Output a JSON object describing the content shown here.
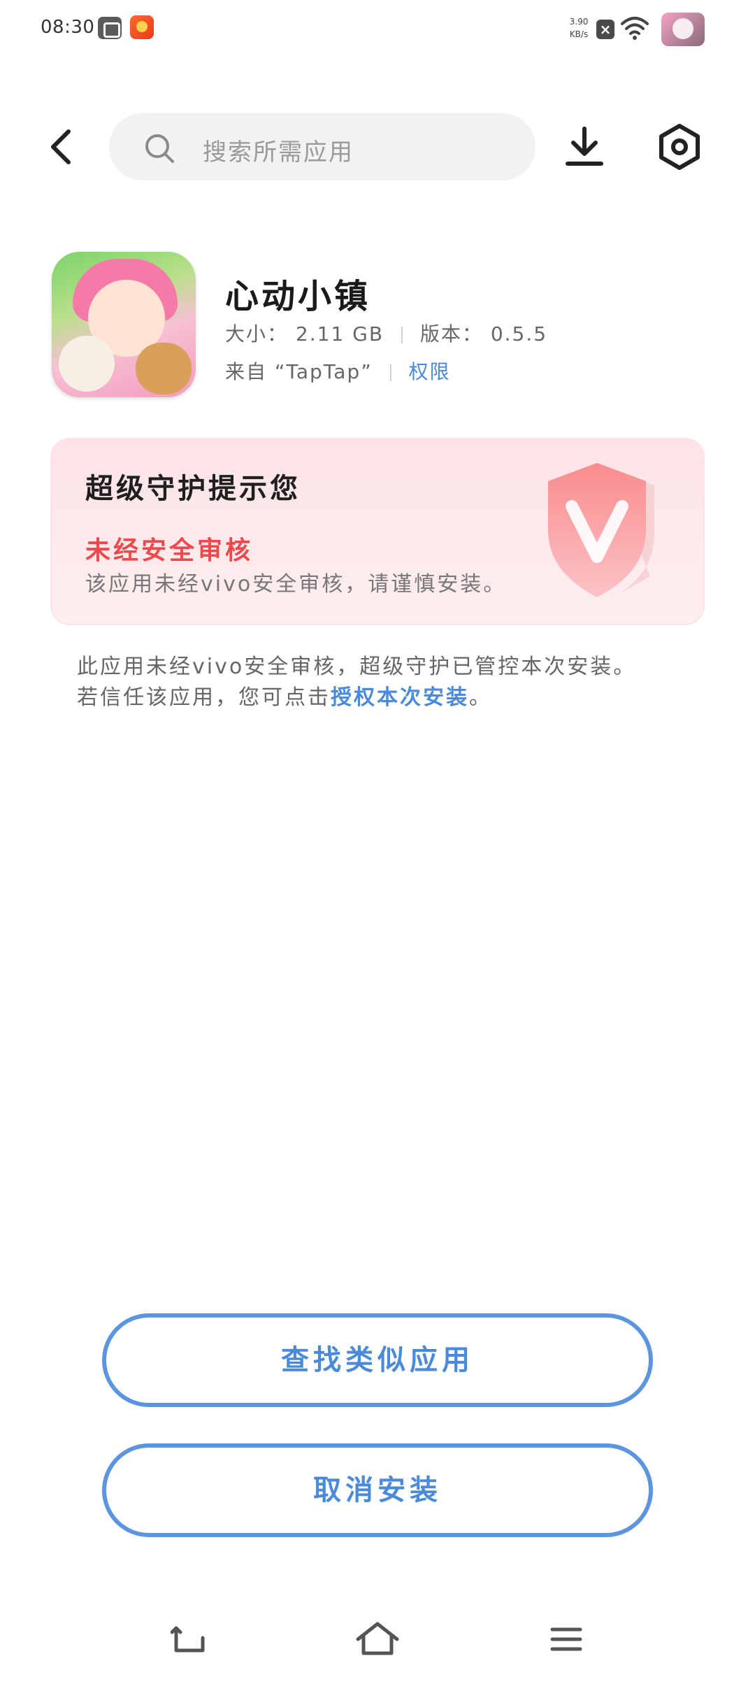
{
  "status_bar": {
    "time": "08:30",
    "net_speed_value": "3.90",
    "net_speed_unit": "KB/s",
    "icons": [
      "notification-app-icon",
      "notification-game-icon",
      "close-icon",
      "wifi-icon",
      "avatar"
    ]
  },
  "top_bar": {
    "search_placeholder": "搜索所需应用",
    "icons": [
      "back-icon",
      "search-icon",
      "download-icon",
      "settings-icon"
    ]
  },
  "app": {
    "name": "心动小镇",
    "size_label": "大小：",
    "size_value": "2.11 GB",
    "version_label": "版本：",
    "version_value": "0.5.5",
    "source": "来自 “TapTap”",
    "permissions_link": "权限"
  },
  "warning": {
    "title": "超级守护提示您",
    "subtitle": "未经安全审核",
    "description": "该应用未经vivo安全审核，请谨慎安装。"
  },
  "info": {
    "line1": "此应用未经vivo安全审核，超级守护已管控本次安装。",
    "line2_prefix": "若信任该应用，您可点击",
    "line2_link": "授权本次安装",
    "line2_suffix": "。"
  },
  "buttons": {
    "find_similar": "查找类似应用",
    "cancel_install": "取消安装"
  },
  "colors": {
    "accent_blue": "#4a8ad9",
    "warning_red": "#f0484a",
    "card_pink": "#fde3e6"
  }
}
